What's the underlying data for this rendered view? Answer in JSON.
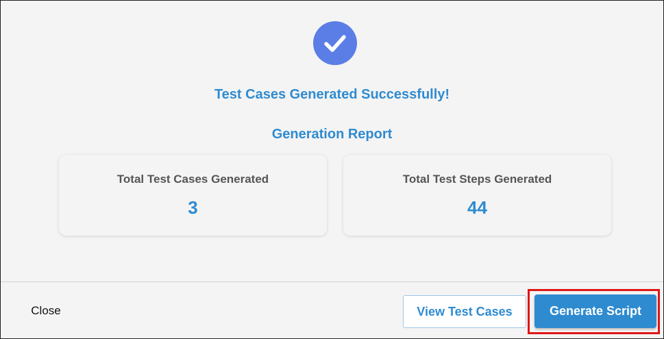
{
  "colors": {
    "accent": "#2f8bd0",
    "check_circle": "#5a7ee6",
    "highlight": "#e01616"
  },
  "icons": {
    "success": "checkmark-icon"
  },
  "dialog": {
    "success_title": "Test Cases Generated Successfully!",
    "report_title": "Generation Report",
    "stats": [
      {
        "label": "Total Test Cases Generated",
        "value": "3"
      },
      {
        "label": "Total Test Steps Generated",
        "value": "44"
      }
    ]
  },
  "footer": {
    "close_label": "Close",
    "view_label": "View Test Cases",
    "generate_label": "Generate Script"
  }
}
